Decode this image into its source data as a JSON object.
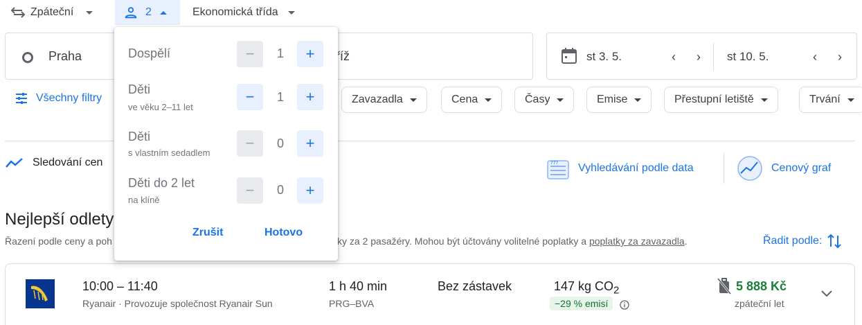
{
  "top_bar": {
    "trip_type": "Zpáteční",
    "passenger_count": "2",
    "cabin_class": "Ekonomická třída"
  },
  "search": {
    "origin": "Praha",
    "destination_partial": "říž",
    "depart_date": "st 3. 5.",
    "return_date": "st 10. 5."
  },
  "filters": {
    "all_filters": "Všechny filtry",
    "chips": [
      "Zavazadla",
      "Cena",
      "Časy",
      "Emise",
      "Přestupní letiště",
      "Trvání"
    ]
  },
  "tools": {
    "tracking": "Sledování cen",
    "date_search": "Vyhledávání podle data",
    "price_graph": "Cenový graf"
  },
  "results": {
    "title": "Nejlepší odlety",
    "sort_note_start": "Řazení podle ceny a poh",
    "sort_note_end": "ky za 2 pasažéry. Mohou být účtovány volitelné poplatky a",
    "sort_note_link": "poplatky za zavazadla",
    "sort_note_tail": ".",
    "sort_by": "Řadit podle:"
  },
  "flight": {
    "times": "10:00 – 11:40",
    "airline": "Ryanair · Provozuje společnost Ryanair Sun",
    "duration": "1 h 40 min",
    "route": "PRG–BVA",
    "stops": "Bez zástavek",
    "co2_value": "147 kg CO",
    "co2_sub": "2",
    "emissions_badge": "−29 % emisí",
    "price": "5 888 Kč",
    "price_type": "zpáteční let"
  },
  "passenger_popup": {
    "rows": [
      {
        "label": "Dospělí",
        "sub": "",
        "count": "1"
      },
      {
        "label": "Děti",
        "sub": "ve věku 2–11 let",
        "count": "1"
      },
      {
        "label": "Děti",
        "sub": "s vlastním sedadlem",
        "count": "0"
      },
      {
        "label": "Děti do 2 let",
        "sub": "na klíně",
        "count": "0"
      }
    ],
    "minus_symbol": "−",
    "plus_symbol": "+",
    "cancel": "Zrušit",
    "done": "Hotovo"
  },
  "colors": {
    "accent": "#1a73e8",
    "price_green": "#188038",
    "badge_bg": "#e6f4ea"
  }
}
